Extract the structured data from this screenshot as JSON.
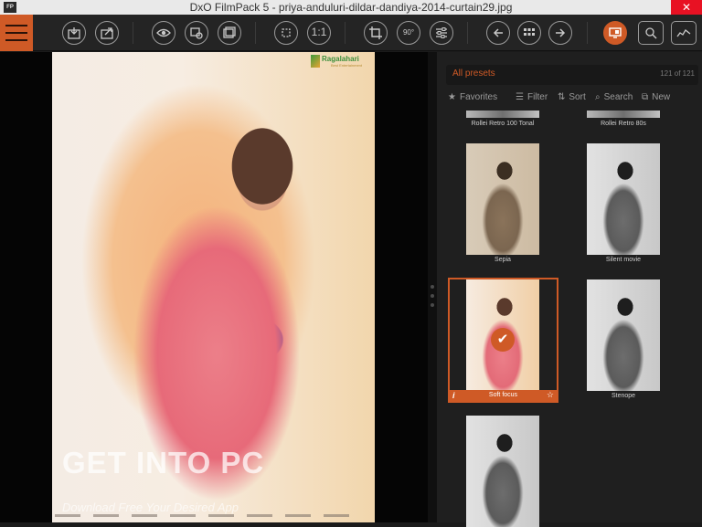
{
  "window": {
    "app_icon": "FP",
    "title": "DxO FilmPack 5 - priya-anduluri-dildar-dandiya-2014-curtain29.jpg",
    "close_glyph": "✕"
  },
  "toolbar": {
    "icons": [
      "menu-icon",
      "import-icon",
      "export-icon",
      "eye-icon",
      "compare-icon",
      "gallery-icon",
      "fit-icon",
      "one-to-one-icon",
      "crop-icon",
      "rotate-90-icon",
      "adjust-icon",
      "prev-icon",
      "grid-icon",
      "next-icon",
      "monitor-icon",
      "zoom-icon",
      "histogram-icon"
    ],
    "one_to_one_label": "1:1",
    "rotate_label": "90°"
  },
  "viewer": {
    "photo_logo_text": "Ragalahari",
    "photo_logo_sub": "Best Entertainment",
    "watermark": "GET INTO PC",
    "watermark_sub": "Download Free Your Desired App"
  },
  "presets": {
    "header_label": "All presets",
    "count_text": "121 of 121",
    "filters": {
      "favorites": "Favorites",
      "filter": "Filter",
      "sort": "Sort",
      "search": "Search",
      "new": "New"
    },
    "items": [
      {
        "name": "Rollei Retro 100 Tonal",
        "style": "bw",
        "selected": false
      },
      {
        "name": "Rollei Retro 80s",
        "style": "bw",
        "selected": false
      },
      {
        "name": "Sepia",
        "style": "sepia",
        "selected": false
      },
      {
        "name": "Silent movie",
        "style": "bw",
        "selected": false
      },
      {
        "name": "Soft focus",
        "style": "color",
        "selected": true
      },
      {
        "name": "Stenope",
        "style": "bw",
        "selected": false
      },
      {
        "name": "",
        "style": "bw",
        "selected": false
      }
    ]
  },
  "colors": {
    "accent": "#cf5a26",
    "background": "#1f1f1f",
    "titlebar": "#e9e9e9",
    "close": "#e81123"
  }
}
